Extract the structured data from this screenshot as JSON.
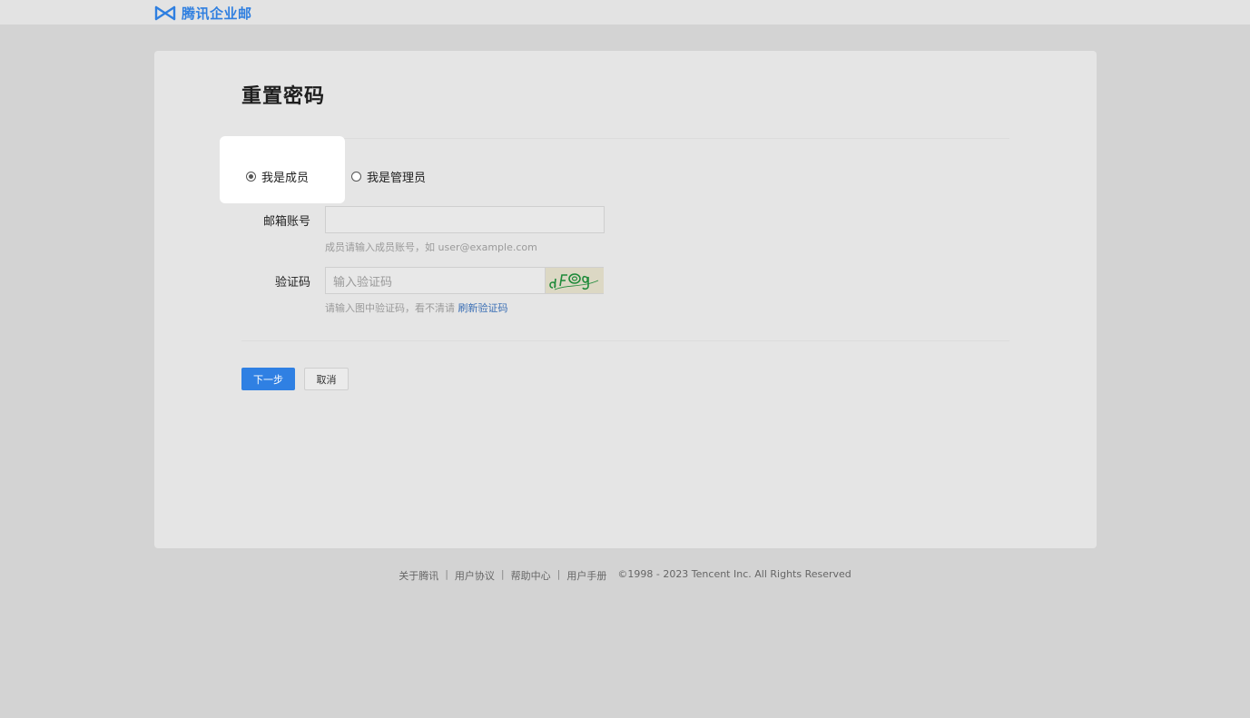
{
  "brand": {
    "name": "腾讯企业邮",
    "accent": "#2f7fe0"
  },
  "page": {
    "title": "重置密码"
  },
  "role": {
    "options": [
      {
        "label": "我是成员",
        "checked": true
      },
      {
        "label": "我是管理员",
        "checked": false
      }
    ]
  },
  "email": {
    "label": "邮箱账号",
    "value": "",
    "placeholder": "",
    "hint": "成员请输入成员账号，如 user@example.com"
  },
  "captcha": {
    "label": "验证码",
    "placeholder": "输入验证码",
    "hint": "请输入图中验证码，看不清请",
    "refresh_label": "刷新验证码",
    "image_text": "dFOg"
  },
  "actions": {
    "next_label": "下一步",
    "cancel_label": "取消"
  },
  "footer": {
    "links": [
      "关于腾讯",
      "用户协议",
      "帮助中心",
      "用户手册"
    ],
    "copyright": "©1998 - 2023 Tencent Inc. All Rights Reserved"
  }
}
